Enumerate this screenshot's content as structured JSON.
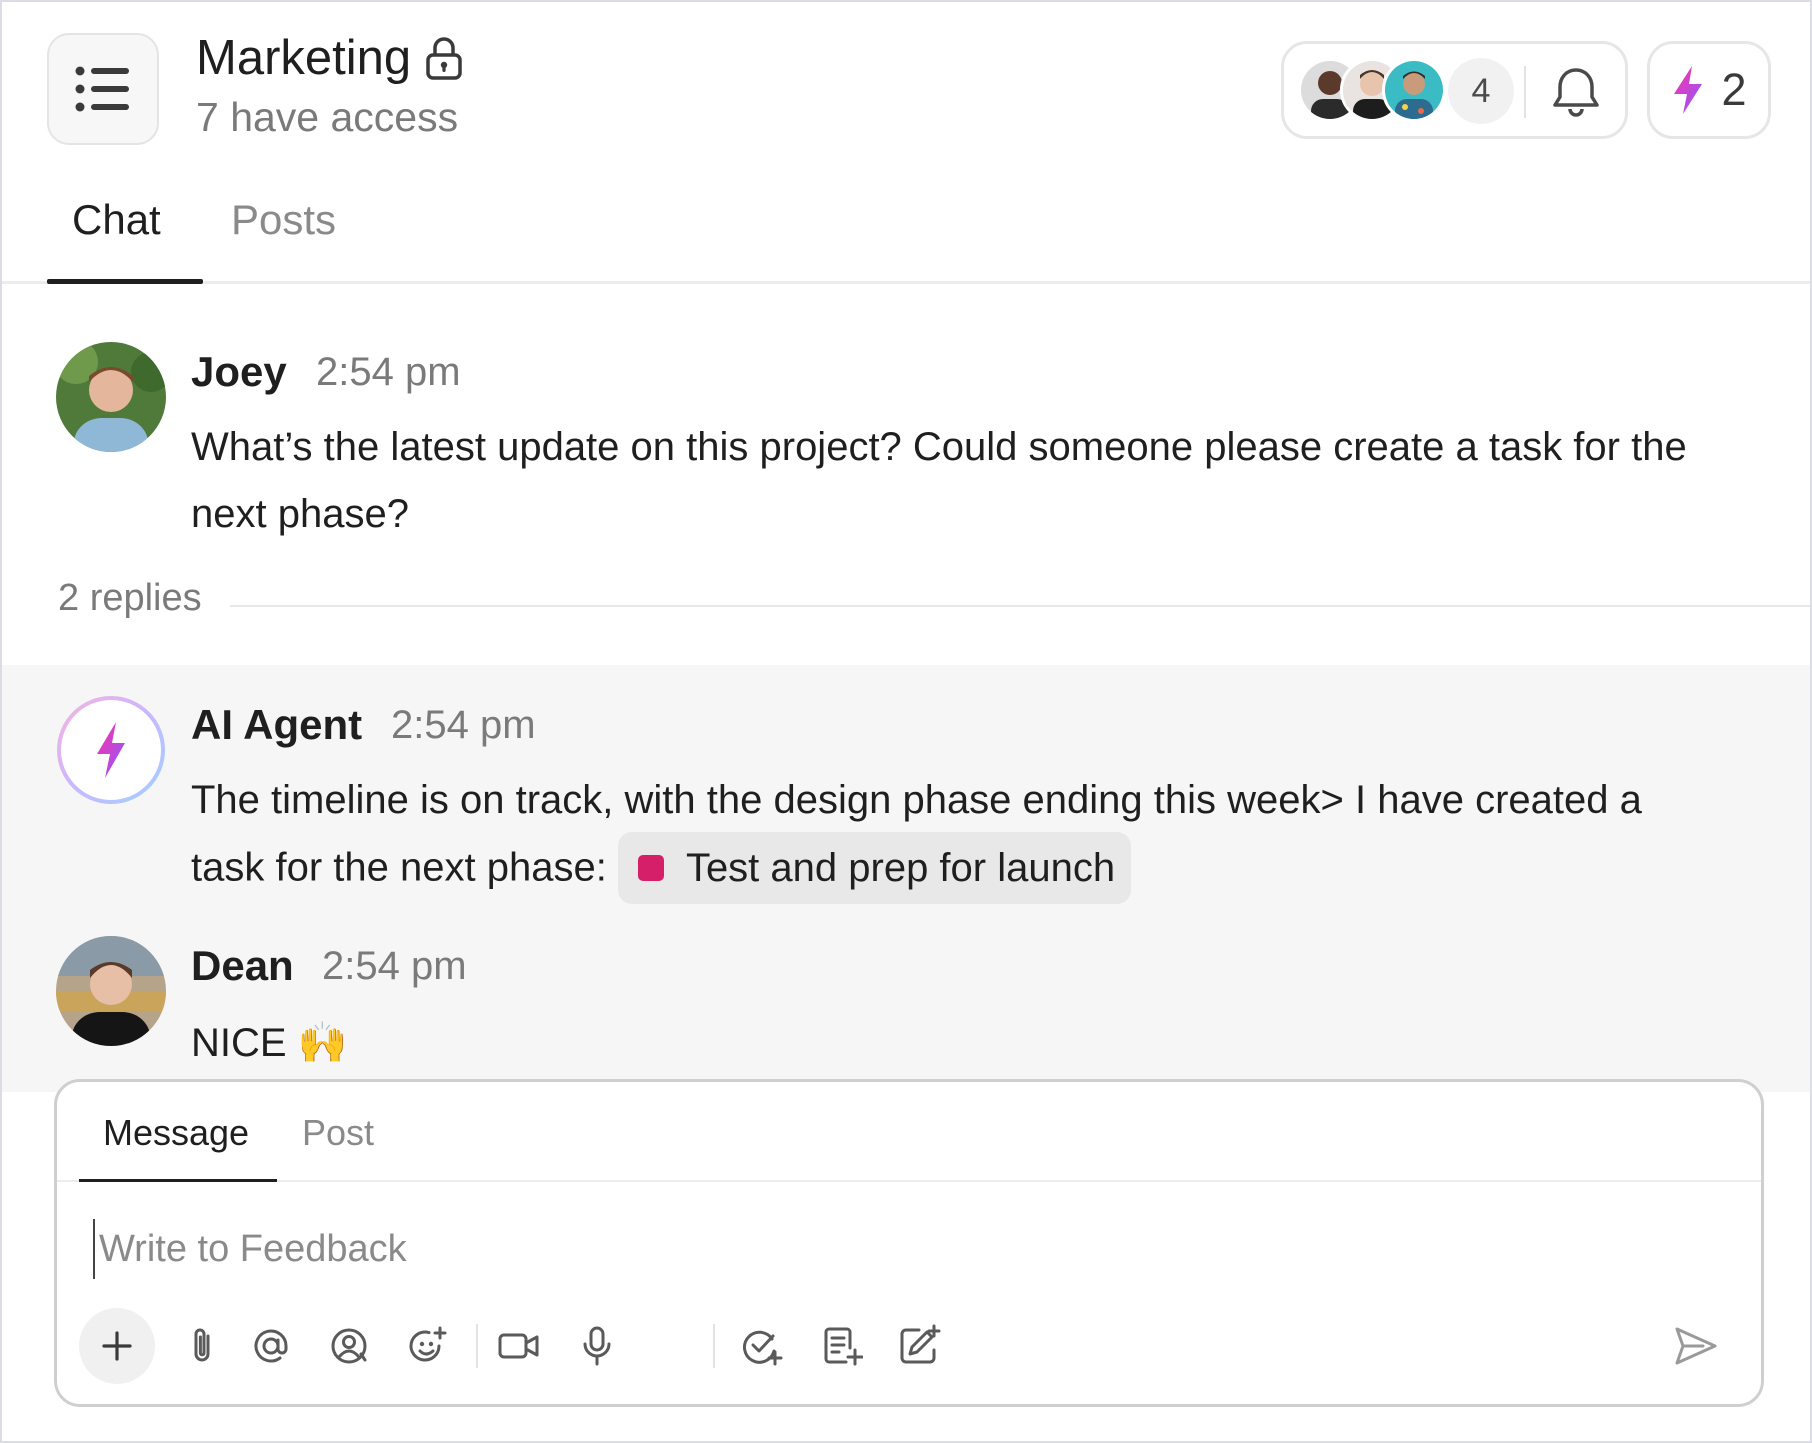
{
  "header": {
    "channel_name": "Marketing",
    "access_text": "7 have access",
    "member_overflow_count": "4",
    "ai_count": "2"
  },
  "tabs": [
    {
      "label": "Chat",
      "active": true
    },
    {
      "label": "Posts",
      "active": false
    }
  ],
  "messages": [
    {
      "author": "Joey",
      "time": "2:54 pm",
      "text": "What’s the latest update on this project? Could someone please create a task for the next phase?"
    },
    {
      "author": "AI Agent",
      "time": "2:54 pm",
      "text": "The timeline is on track, with the design phase ending this week> I have created a task for the next phase:",
      "task_label": "Test and prep for launch",
      "task_color": "#d61f69"
    },
    {
      "author": "Dean",
      "time": "2:54 pm",
      "text": "NICE 🙌"
    }
  ],
  "replies_text": "2 replies",
  "composer": {
    "tabs": [
      {
        "label": "Message",
        "active": true
      },
      {
        "label": "Post",
        "active": false
      }
    ],
    "placeholder": "Write to Feedback",
    "value": "",
    "toolbar_icons": [
      "plus-icon",
      "attachment-icon",
      "mention-icon",
      "user-mention-icon",
      "emoji-icon",
      "video-icon",
      "microphone-icon",
      "task-icon",
      "doc-icon",
      "whiteboard-icon",
      "send-icon"
    ]
  },
  "colors": {
    "accent_gradient_start": "#ff2fa8",
    "accent_gradient_end": "#8b5cff",
    "thread_background": "#f6f6f6"
  }
}
